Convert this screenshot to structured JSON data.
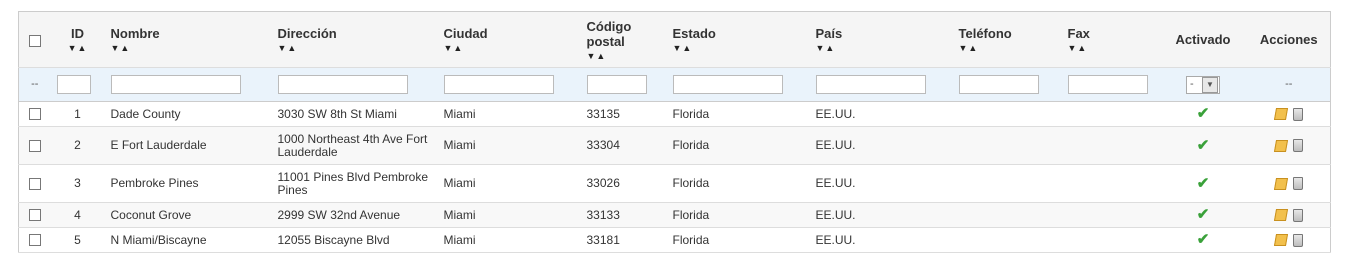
{
  "columns": {
    "id": "ID",
    "nombre": "Nombre",
    "direccion": "Dirección",
    "ciudad": "Ciudad",
    "codigo_postal_1": "Código",
    "codigo_postal_2": "postal",
    "estado": "Estado",
    "pais": "País",
    "telefono": "Teléfono",
    "fax": "Fax",
    "activado": "Activado",
    "acciones": "Acciones"
  },
  "sort_arrows": "▼▲",
  "sort_arrows_id": "▼▲",
  "filter": {
    "placeholder_dash": "--",
    "activado_select": "-",
    "acciones_dash": "--"
  },
  "rows": [
    {
      "id": "1",
      "nombre": "Dade County",
      "direccion": "3030 SW 8th St Miami",
      "ciudad": "Miami",
      "cp": "33135",
      "estado": "Florida",
      "pais": "EE.UU.",
      "telefono": "",
      "fax": ""
    },
    {
      "id": "2",
      "nombre": "E Fort Lauderdale",
      "direccion": "1000 Northeast 4th Ave Fort Lauderdale",
      "ciudad": "Miami",
      "cp": "33304",
      "estado": "Florida",
      "pais": "EE.UU.",
      "telefono": "",
      "fax": ""
    },
    {
      "id": "3",
      "nombre": "Pembroke Pines",
      "direccion": "11001 Pines Blvd Pembroke Pines",
      "ciudad": "Miami",
      "cp": "33026",
      "estado": "Florida",
      "pais": "EE.UU.",
      "telefono": "",
      "fax": ""
    },
    {
      "id": "4",
      "nombre": "Coconut Grove",
      "direccion": "2999 SW 32nd Avenue",
      "ciudad": "Miami",
      "cp": "33133",
      "estado": "Florida",
      "pais": "EE.UU.",
      "telefono": "",
      "fax": ""
    },
    {
      "id": "5",
      "nombre": "N Miami/Biscayne",
      "direccion": "12055 Biscayne Blvd",
      "ciudad": "Miami",
      "cp": "33181",
      "estado": "Florida",
      "pais": "EE.UU.",
      "telefono": "",
      "fax": ""
    }
  ],
  "icons": {
    "activated": "check-icon",
    "edit": "edit-icon",
    "delete": "delete-icon"
  },
  "colors": {
    "check": "#3aa13a",
    "filter_row": "#eaf3fb"
  }
}
